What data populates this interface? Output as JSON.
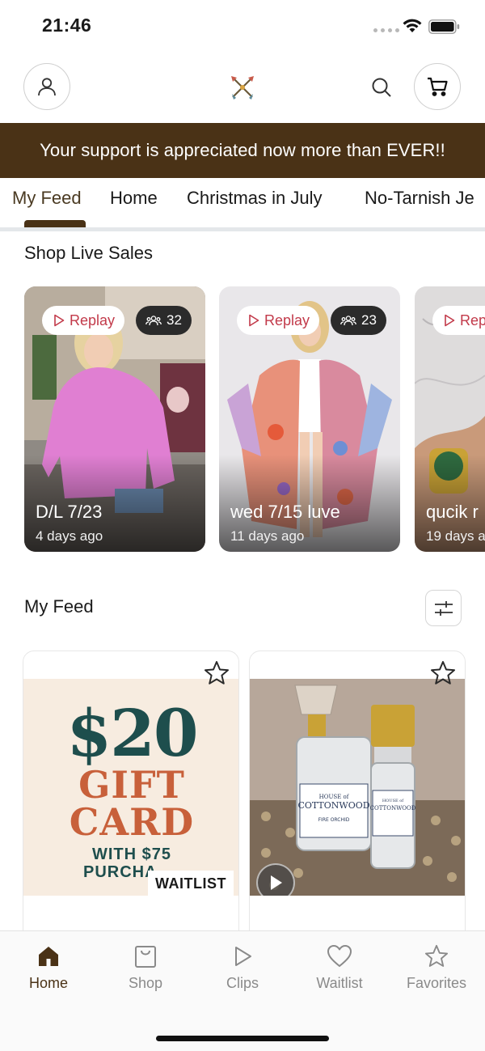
{
  "status_bar": {
    "time": "21:46"
  },
  "header": {
    "logo": "crossed-arrows-logo"
  },
  "banner": {
    "text": "Your support is appreciated now more than EVER!!"
  },
  "tabs": [
    {
      "label": "My Feed",
      "active": true
    },
    {
      "label": "Home",
      "active": false
    },
    {
      "label": "Christmas in July",
      "active": false
    },
    {
      "label": "No-Tarnish Je",
      "active": false
    }
  ],
  "live_sales": {
    "title": "Shop Live Sales",
    "replay_label": "Replay",
    "cards": [
      {
        "title": "D/L 7/23",
        "age": "4 days ago",
        "viewers": "32"
      },
      {
        "title": "wed 7/15 luve",
        "age": "11 days ago",
        "viewers": "23"
      },
      {
        "title": "qucik r",
        "age": "19 days a",
        "viewers": ""
      }
    ]
  },
  "feed": {
    "title": "My Feed",
    "products": [
      {
        "gc_amount": "$20",
        "gc_line1": "GIFT",
        "gc_line2": "CARD",
        "gc_small1": "WITH $75",
        "gc_small2": "PURCHA",
        "badge": "WAITLIST"
      },
      {
        "brand_label": "HOUSE of COTTONWOOD",
        "scent_label": "FIRE ORCHID"
      }
    ]
  },
  "bottom_nav": [
    {
      "label": "Home",
      "icon": "home-icon",
      "active": true
    },
    {
      "label": "Shop",
      "icon": "shop-bag-icon",
      "active": false
    },
    {
      "label": "Clips",
      "icon": "play-icon",
      "active": false
    },
    {
      "label": "Waitlist",
      "icon": "heart-icon",
      "active": false
    },
    {
      "label": "Favorites",
      "icon": "star-icon",
      "active": false
    }
  ],
  "colors": {
    "brand_brown": "#4a3216",
    "replay_red": "#c23a4a",
    "giftcard_teal": "#1e4e4d",
    "giftcard_orange": "#c8603a"
  }
}
